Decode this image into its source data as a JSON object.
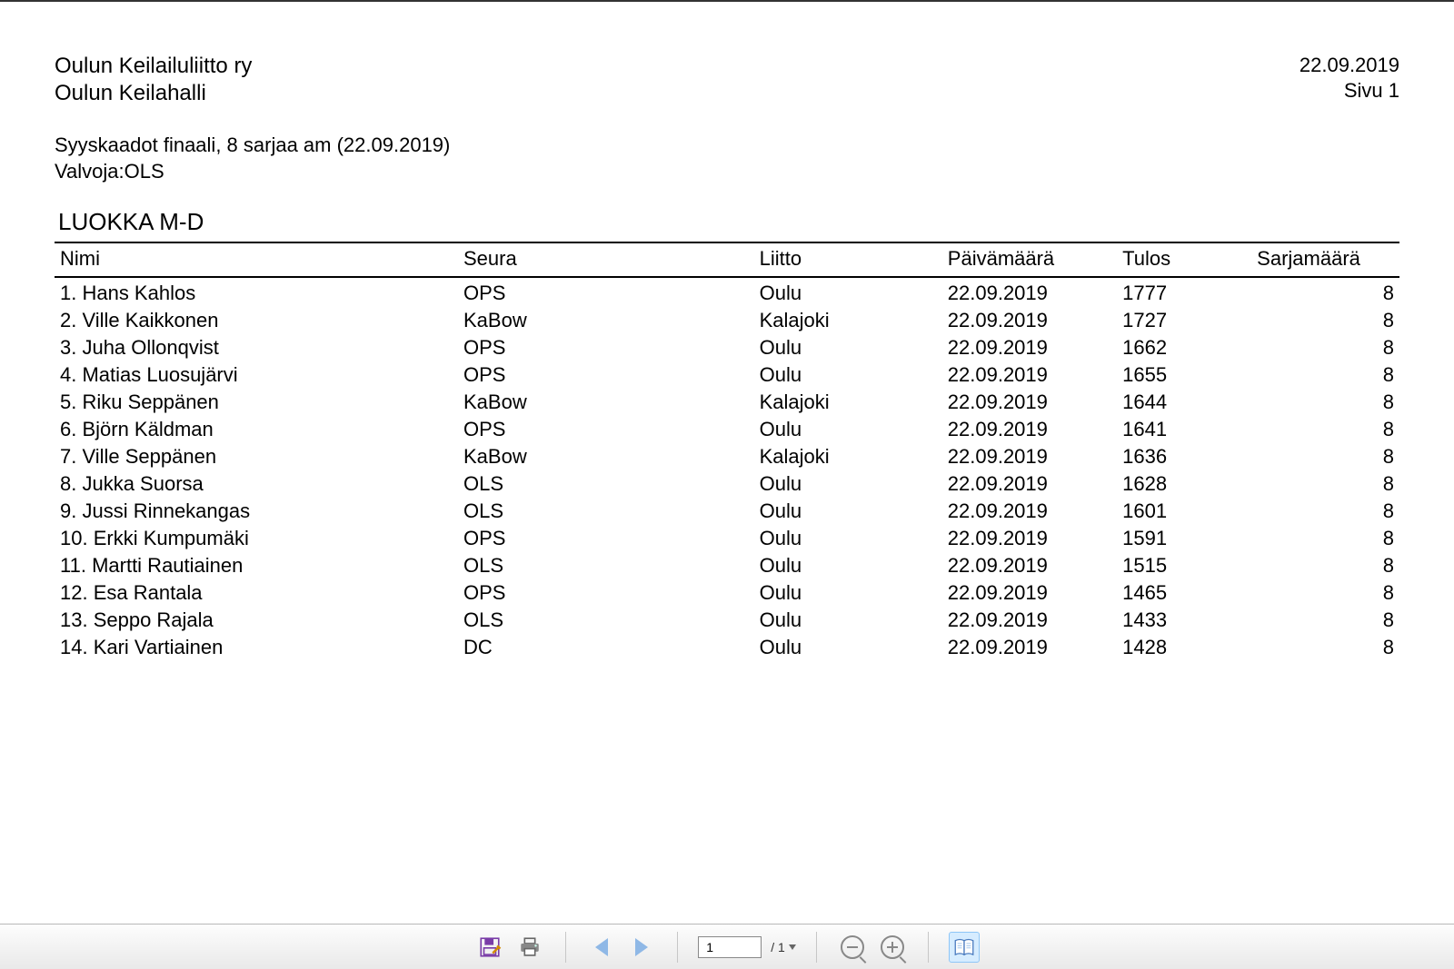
{
  "header": {
    "org": "Oulun Keilailuliitto ry",
    "venue": "Oulun Keilahalli",
    "date": "22.09.2019",
    "page_label": "Sivu 1"
  },
  "event": {
    "title": "Syyskaadot finaali, 8 sarjaa am (22.09.2019)",
    "supervisor": "Valvoja:OLS"
  },
  "section_title": "LUOKKA M-D",
  "columns": {
    "nimi": "Nimi",
    "seura": "Seura",
    "liitto": "Liitto",
    "pvm": "Päivämäärä",
    "tulos": "Tulos",
    "sarja": "Sarjamäärä"
  },
  "rows": [
    {
      "rank": "1.",
      "name": "Hans Kahlos",
      "club": "OPS",
      "assoc": "Oulu",
      "date": "22.09.2019",
      "score": "1777",
      "series": "8"
    },
    {
      "rank": "2.",
      "name": "Ville Kaikkonen",
      "club": "KaBow",
      "assoc": "Kalajoki",
      "date": "22.09.2019",
      "score": "1727",
      "series": "8"
    },
    {
      "rank": "3.",
      "name": "Juha Ollonqvist",
      "club": "OPS",
      "assoc": "Oulu",
      "date": "22.09.2019",
      "score": "1662",
      "series": "8"
    },
    {
      "rank": "4.",
      "name": "Matias Luosujärvi",
      "club": "OPS",
      "assoc": "Oulu",
      "date": "22.09.2019",
      "score": "1655",
      "series": "8"
    },
    {
      "rank": "5.",
      "name": "Riku Seppänen",
      "club": "KaBow",
      "assoc": "Kalajoki",
      "date": "22.09.2019",
      "score": "1644",
      "series": "8"
    },
    {
      "rank": "6.",
      "name": "Björn Käldman",
      "club": "OPS",
      "assoc": "Oulu",
      "date": "22.09.2019",
      "score": "1641",
      "series": "8"
    },
    {
      "rank": "7.",
      "name": "Ville Seppänen",
      "club": "KaBow",
      "assoc": "Kalajoki",
      "date": "22.09.2019",
      "score": "1636",
      "series": "8"
    },
    {
      "rank": "8.",
      "name": "Jukka Suorsa",
      "club": "OLS",
      "assoc": "Oulu",
      "date": "22.09.2019",
      "score": "1628",
      "series": "8"
    },
    {
      "rank": "9.",
      "name": "Jussi Rinnekangas",
      "club": "OLS",
      "assoc": "Oulu",
      "date": "22.09.2019",
      "score": "1601",
      "series": "8"
    },
    {
      "rank": "10.",
      "name": "Erkki Kumpumäki",
      "club": "OPS",
      "assoc": "Oulu",
      "date": "22.09.2019",
      "score": "1591",
      "series": "8"
    },
    {
      "rank": "11.",
      "name": "Martti Rautiainen",
      "club": "OLS",
      "assoc": "Oulu",
      "date": "22.09.2019",
      "score": "1515",
      "series": "8"
    },
    {
      "rank": "12.",
      "name": "Esa Rantala",
      "club": "OPS",
      "assoc": "Oulu",
      "date": "22.09.2019",
      "score": "1465",
      "series": "8"
    },
    {
      "rank": "13.",
      "name": "Seppo Rajala",
      "club": "OLS",
      "assoc": "Oulu",
      "date": "22.09.2019",
      "score": "1433",
      "series": "8"
    },
    {
      "rank": "14.",
      "name": "Kari Vartiainen",
      "club": "DC",
      "assoc": "Oulu",
      "date": "22.09.2019",
      "score": "1428",
      "series": "8"
    }
  ],
  "toolbar": {
    "page_current": "1",
    "page_total": "/ 1"
  }
}
